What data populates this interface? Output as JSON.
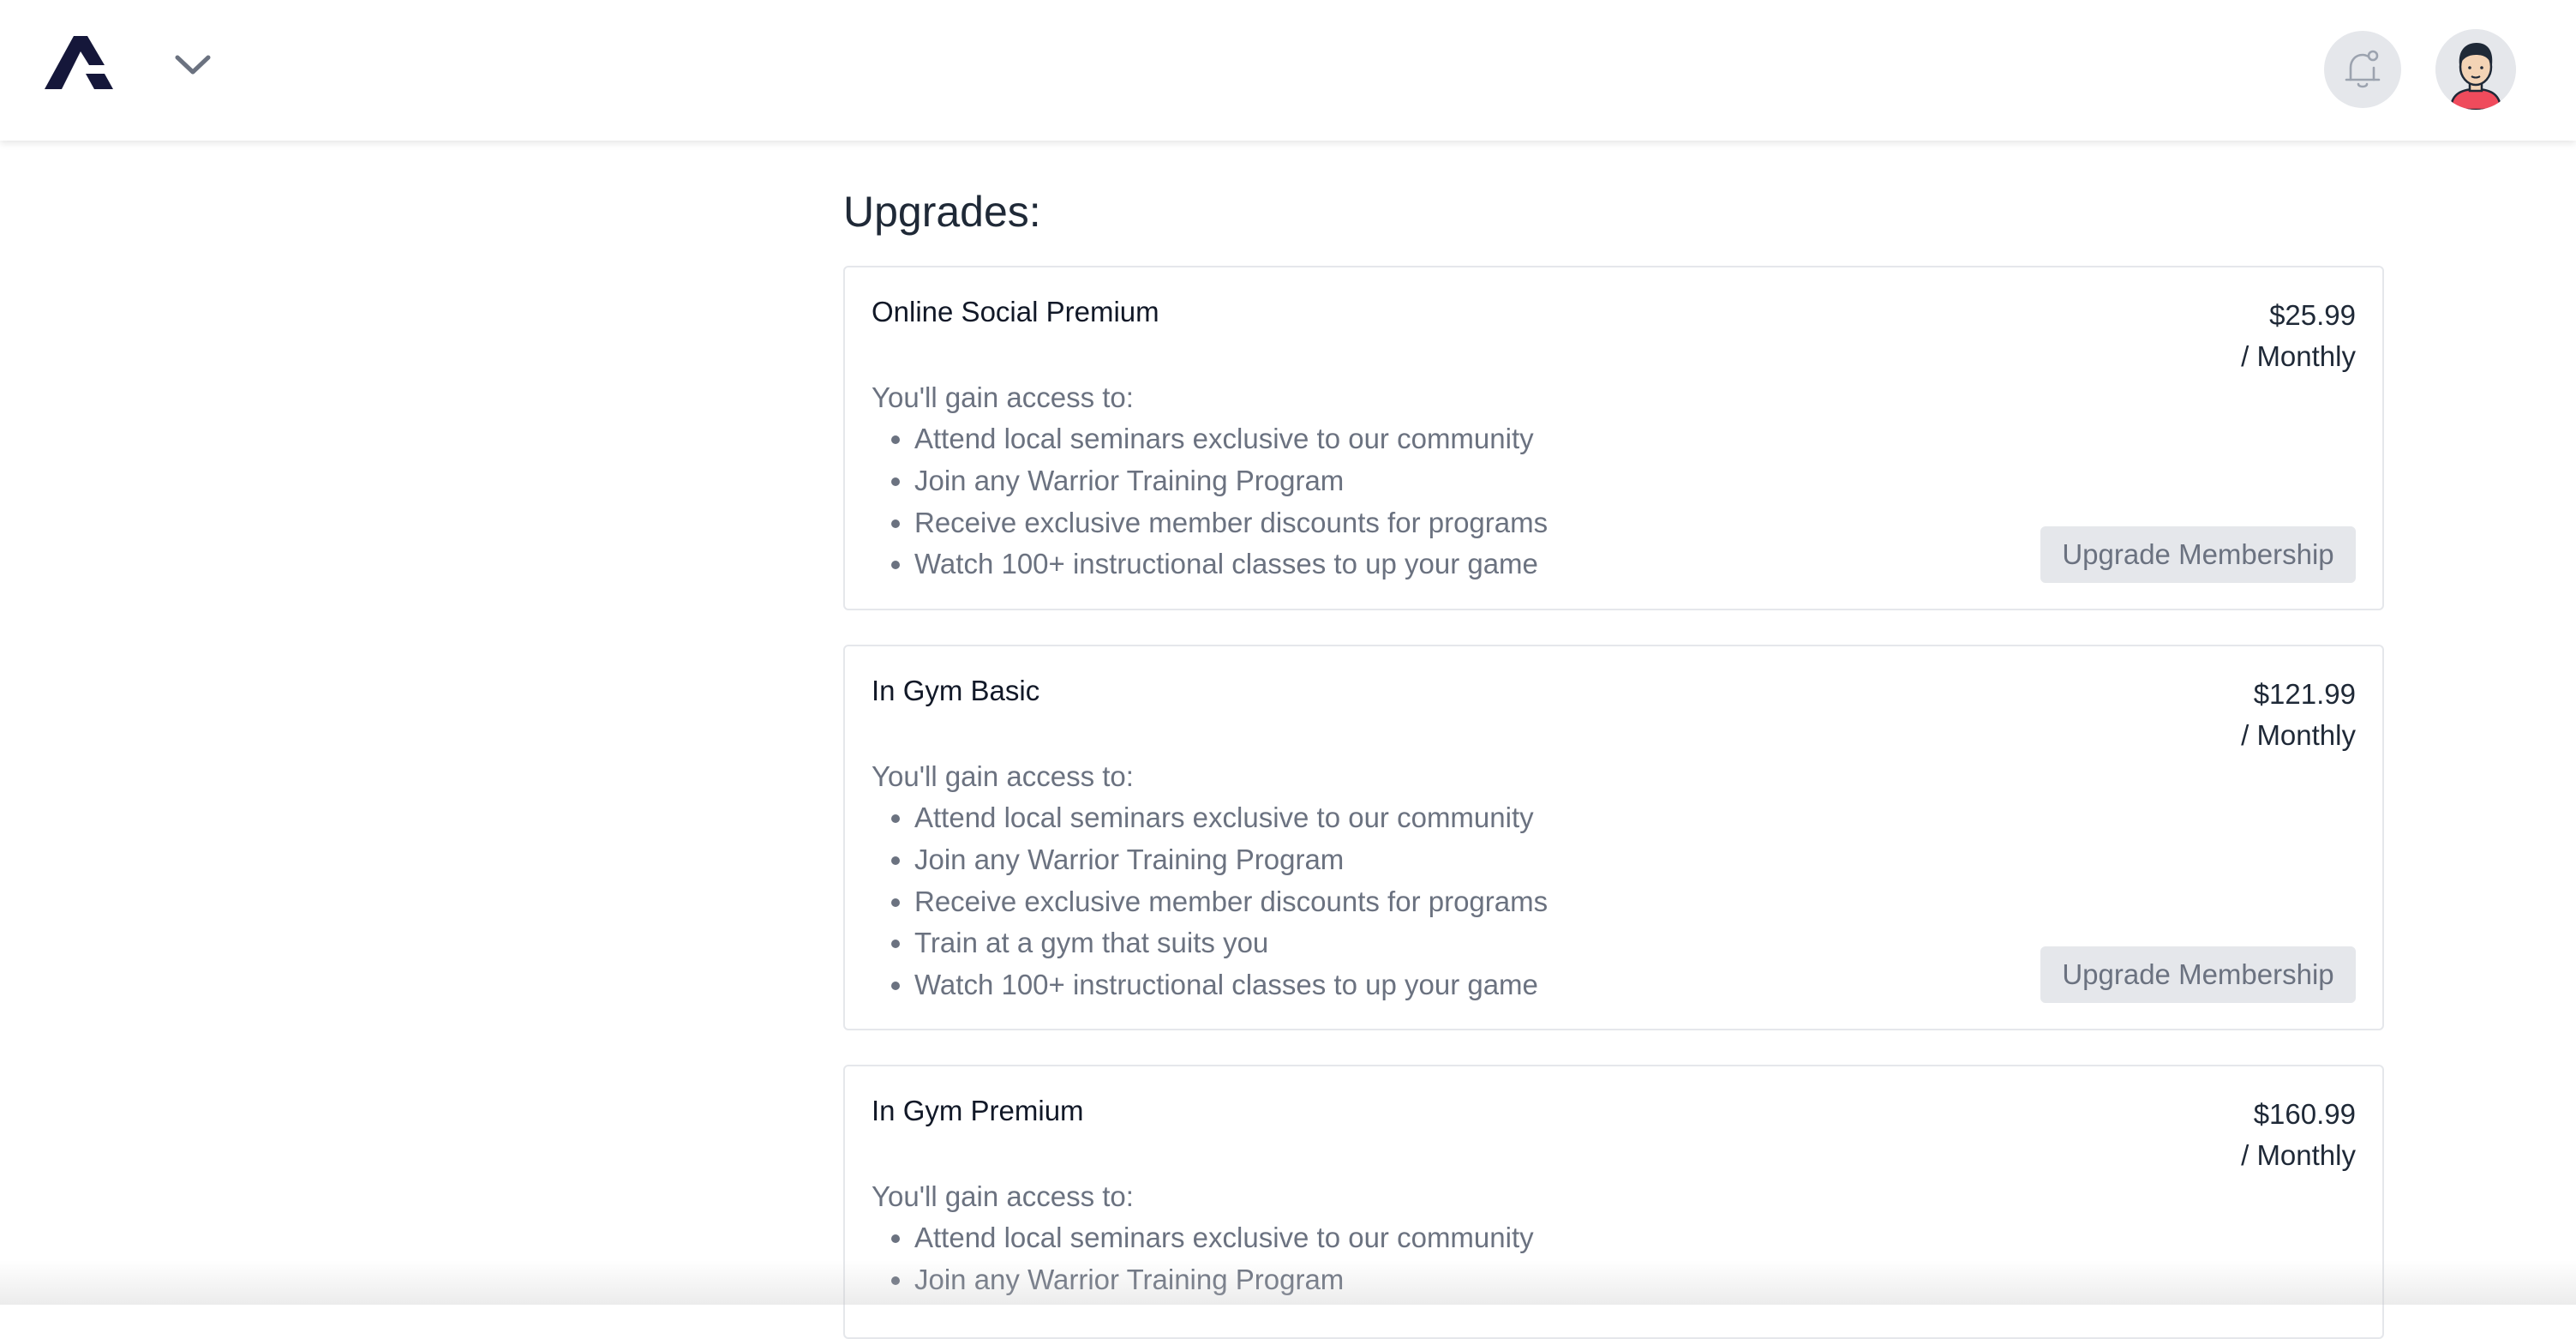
{
  "header": {
    "logo_icon": "brand-logo-icon",
    "menu_icon": "chevron-down-icon",
    "notifications_icon": "bell-icon",
    "avatar_icon": "user-avatar-icon"
  },
  "colors": {
    "brand": "#15173a",
    "button_bg": "#e5e7eb",
    "muted_text": "#6b7280",
    "avatar_shirt": "#ef4b5c"
  },
  "upgrades": {
    "title": "Upgrades:",
    "plans": [
      {
        "name": "Online Social Premium",
        "price": "$25.99",
        "period": "/ Monthly",
        "intro": "You'll gain access to:",
        "features": [
          "Attend local seminars exclusive to our community",
          "Join any Warrior Training Program",
          "Receive exclusive member discounts for programs",
          "Watch 100+ instructional classes to up your game"
        ],
        "button_label": "Upgrade Membership"
      },
      {
        "name": "In Gym Basic",
        "price": "$121.99",
        "period": "/ Monthly",
        "intro": "You'll gain access to:",
        "features": [
          "Attend local seminars exclusive to our community",
          "Join any Warrior Training Program",
          "Receive exclusive member discounts for programs",
          "Train at a gym that suits you",
          "Watch 100+ instructional classes to up your game"
        ],
        "button_label": "Upgrade Membership"
      },
      {
        "name": "In Gym Premium",
        "price": "$160.99",
        "period": "/ Monthly",
        "intro": "You'll gain access to:",
        "features": [
          "Attend local seminars exclusive to our community",
          "Join any Warrior Training Program"
        ]
      }
    ]
  }
}
